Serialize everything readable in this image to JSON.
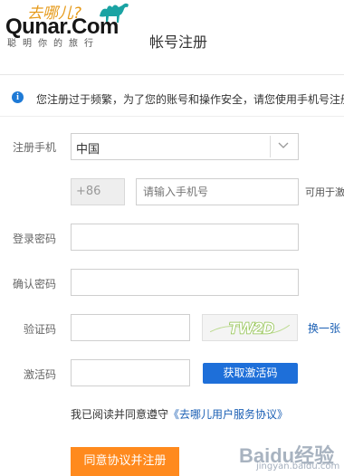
{
  "header": {
    "logo_cn": "去哪儿?",
    "logo_text": "Qunar.Com",
    "logo_slogan": "聪明你的旅行",
    "page_title": "帐号注册"
  },
  "notice": {
    "icon": "info-icon",
    "icon_glyph": "i",
    "text": "您注册过于频繁，为了您的账号和操作安全，请您使用手机号注册"
  },
  "form": {
    "phone_label": "注册手机",
    "country_value": "中国",
    "country_code": "+86",
    "phone_placeholder": "请输入手机号",
    "phone_hint": "可用于激活",
    "password_label": "登录密码",
    "password_value": "",
    "confirm_label": "确认密码",
    "confirm_value": "",
    "captcha_label": "验证码",
    "captcha_value": "",
    "captcha_image_text": "TW2D",
    "captcha_refresh": "换一张",
    "activation_label": "激活码",
    "activation_value": "",
    "get_code_button": "获取激活码",
    "agree_prefix": "我已阅读并同意遵守",
    "agree_link": "《去哪儿用户服务协议》",
    "submit_button": "同意协议并注册"
  },
  "watermark": {
    "logo": "Baidu经验",
    "site": "jingyan.baidu.com"
  },
  "colors": {
    "brand_orange": "#ff8a1e",
    "primary_blue": "#1e6fd9",
    "link_blue": "#1a5fb4",
    "logo_orange": "#e69a1a",
    "captcha_green": "#8fc24a"
  }
}
